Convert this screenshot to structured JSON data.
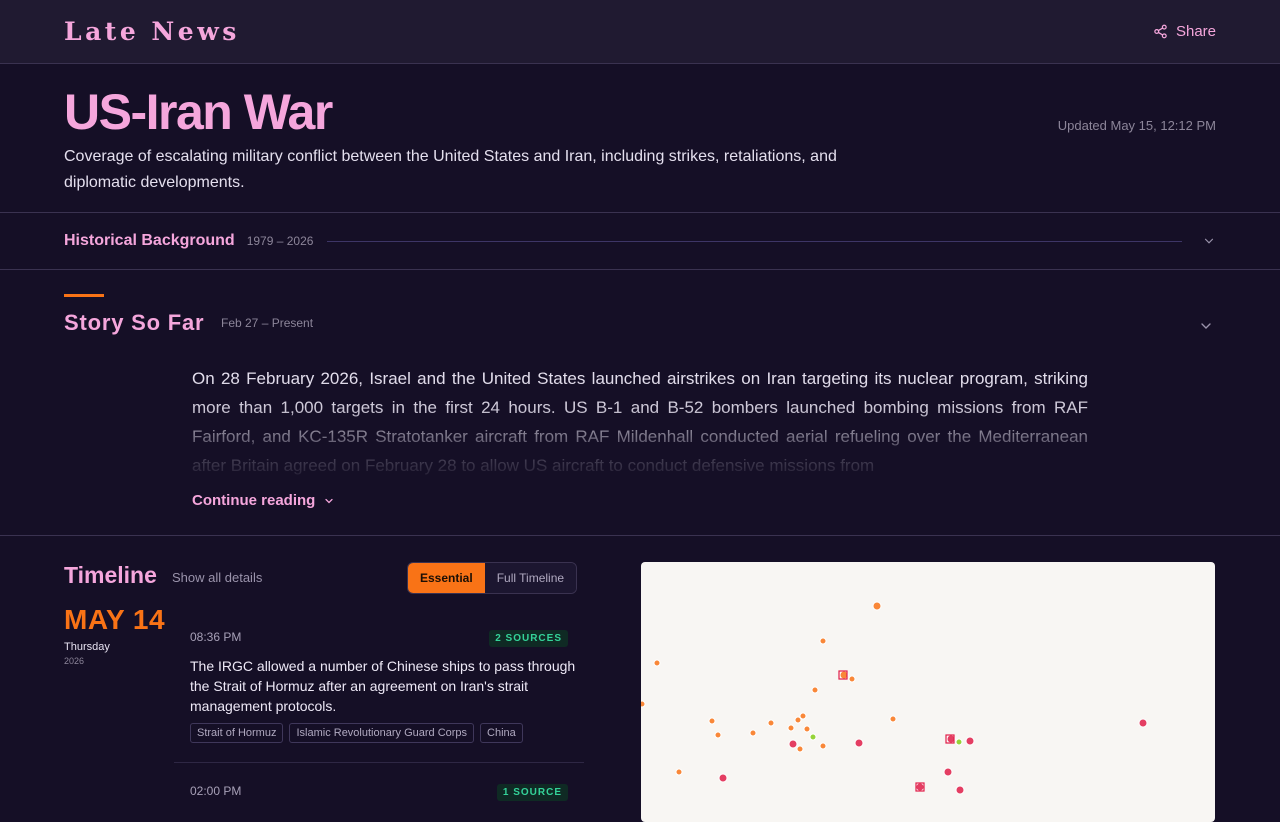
{
  "header": {
    "logo": "Late News",
    "share_label": "Share"
  },
  "hero": {
    "title": "US-Iran War",
    "updated": "Updated May 15, 12:12 PM",
    "description": "Coverage of escalating military conflict between the United States and Iran, including strikes, retaliations, and diplomatic developments."
  },
  "background": {
    "title": "Historical Background",
    "range": "1979 – 2026"
  },
  "story": {
    "title": "Story So Far",
    "range": "Feb 27 – Present",
    "text": "On 28 February 2026, Israel and the United States launched airstrikes on Iran targeting its nuclear program, striking more than 1,000 targets in the first 24 hours. US B-1 and B-52 bombers launched bombing missions from RAF Fairford, and KC-135R Stratotanker aircraft from RAF Mildenhall conducted aerial refueling over the Mediterranean after Britain agreed on February 28 to allow US aircraft to conduct defensive missions from",
    "continue_label": "Continue reading"
  },
  "timeline": {
    "title": "Timeline",
    "show_all": "Show all details",
    "tabs": [
      "Essential",
      "Full Timeline"
    ],
    "active_tab": "Essential",
    "date": {
      "day_month": "MAY 14",
      "weekday": "Thursday",
      "year": "2026"
    },
    "events": [
      {
        "time": "08:36 PM",
        "sources": "2 SOURCES",
        "text": "The IRGC allowed a number of Chinese ships to pass through the Strait of Hormuz after an agreement on Iran's strait management protocols.",
        "tags": [
          "Strait of Hormuz",
          "Islamic Revolutionary Guard Corps",
          "China"
        ]
      },
      {
        "time": "02:00 PM",
        "sources": "1 SOURCE"
      }
    ]
  },
  "map": {
    "colors": {
      "orange": "#f97316",
      "red": "#e11d48",
      "green": "#84cc16",
      "background": "#f8f6f3"
    }
  },
  "colors": {
    "accent_pink": "#f5a6dc",
    "accent_orange": "#f97316",
    "background": "#150f26",
    "badge_green": "#34d399"
  }
}
